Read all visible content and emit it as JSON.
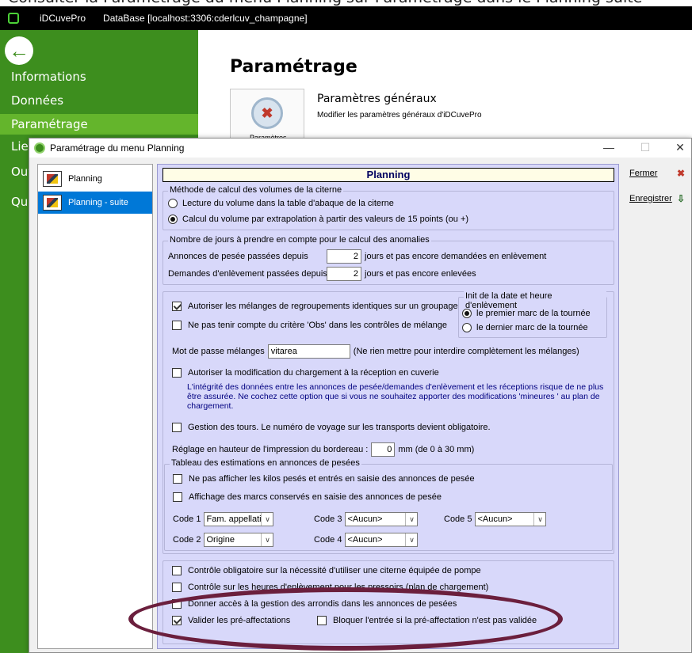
{
  "top_caption": "Consulter la Paramétrage du menu Planning sur Paramétrage dans le Planning suite",
  "app": {
    "title": "iDCuvePro",
    "database": "DataBase [localhost:3306:cderlcuv_champagne]"
  },
  "sidebar": {
    "items": [
      "Informations",
      "Données",
      "Paramétrage",
      "Lier",
      "Out",
      "Qui"
    ]
  },
  "main": {
    "title": "Paramétrage",
    "tile_label": "Paramètres",
    "section_title": "Paramètres généraux",
    "section_subtitle": "Modifier les paramètres généraux d'iDCuvePro"
  },
  "dialog": {
    "title": "Paramétrage du menu Planning",
    "controls": {
      "minimize": "—",
      "maximize": "☐",
      "close": "✕"
    },
    "pages": [
      "Planning",
      "Planning - suite"
    ],
    "panel_title": "Planning",
    "volume_group": {
      "title": "Méthode de calcul des volumes de la citerne",
      "options": [
        "Lecture du volume dans la table d'abaque de la citerne",
        "Calcul du volume par extrapolation à partir des valeurs de 15 points (ou +)"
      ]
    },
    "days_group": {
      "title": "Nombre de jours à prendre en compte pour le calcul des anomalies",
      "row1_label": "Annonces de pesée passées depuis",
      "row1_value": "2",
      "row1_suffix": "jours et pas encore demandées en enlèvement",
      "row2_label": "Demandes d'enlèvement passées depuis",
      "row2_value": "2",
      "row2_suffix": "jours et pas encore enlevées"
    },
    "mix": {
      "allow_label": "Autoriser les mélanges de regroupements identiques sur un groupage",
      "obs_label": "Ne pas tenir compte du critère 'Obs' dans les contrôles de mélange",
      "init_title": "Init de la date et heure d'enlèvement",
      "init_options": [
        "le premier marc de la tournée",
        "le dernier marc de la tournée"
      ],
      "password_label": "Mot de passe mélanges",
      "password_value": "vitarea",
      "password_hint": "(Ne rien mettre pour interdire complètement les mélanges)"
    },
    "reception": {
      "label": "Autoriser la modification du chargement à la réception en cuverie",
      "info": "L'intégrité des données entre les annonces de pesée/demandes d'enlèvement et les réceptions risque de ne plus être assurée. Ne cochez cette option que si vous ne souhaitez apporter des modifications 'mineures ' au plan de chargement."
    },
    "tours_label": "Gestion des tours. Le numéro de voyage sur les transports devient obligatoire.",
    "print_label": "Réglage en hauteur de l'impression du bordereau :",
    "print_value": "0",
    "print_suffix": "mm (de 0 à 30 mm)",
    "estimates": {
      "title": "Tableau des estimations en annonces de pesées",
      "opt1": "Ne pas afficher les kilos pesés et entrés en saisie des annonces de pesée",
      "opt2": "Affichage des marcs conservés en saisie des annonces de pesée",
      "codes": [
        {
          "label": "Code 1",
          "value": "Fam. appellatic"
        },
        {
          "label": "Code 2",
          "value": "Origine"
        },
        {
          "label": "Code 3",
          "value": "<Aucun>"
        },
        {
          "label": "Code 4",
          "value": "<Aucun>"
        },
        {
          "label": "Code 5",
          "value": "<Aucun>"
        }
      ]
    },
    "bottom": {
      "opt1": "Contrôle obligatoire sur la nécessité d'utiliser une citerne équipée de pompe",
      "opt2": "Contrôle sur les heures d'enlèvement pour les pressoirs (plan de chargement)",
      "opt3": "Donner accès à la gestion des arrondis dans les annonces de pesées",
      "opt4": "Valider les pré-affectations",
      "opt5": "Bloquer l'entrée si la pré-affectation n'est pas validée"
    },
    "buttons": {
      "close": "Fermer",
      "save": "Enregistrer"
    }
  },
  "colors": {
    "sidebar": "#3d8e1e",
    "sidebar_active": "#64b52c",
    "panel": "#d8d8fa",
    "selected": "#0078d7",
    "highlight": "#6b1f3d"
  }
}
